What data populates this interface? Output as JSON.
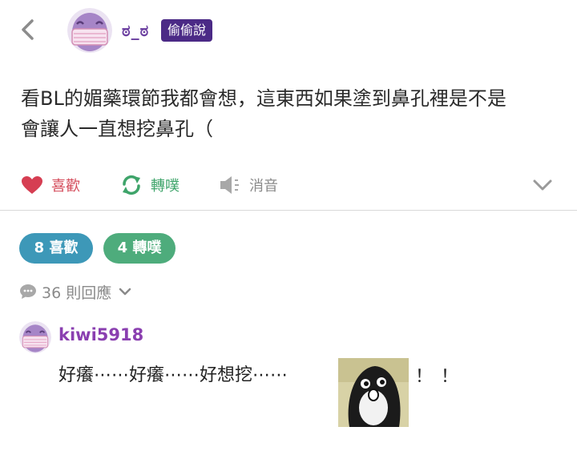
{
  "header": {
    "username": "ಠ_ಠ",
    "badge": "偷偷說"
  },
  "post": {
    "lines": [
      "看BL的媚藥環節我都會想，這東西如果塗到鼻孔裡是不是",
      "會讓人一直想挖鼻孔（"
    ]
  },
  "actions": {
    "like": "喜歡",
    "replurk": "轉噗",
    "mute": "消音"
  },
  "stats": {
    "likes": "8 喜歡",
    "replurks": "4 轉噗",
    "responses": "36 則回應"
  },
  "comment": {
    "username": "kiwi5918",
    "text": "好癢⋯⋯好癢⋯⋯好想挖⋯⋯",
    "trailing": "！！"
  },
  "colors": {
    "brand_purple": "#4b2a86",
    "like_red": "#d44b5a",
    "replurk_green": "#3ea46a",
    "pill_blue": "#3d98b8",
    "pill_green": "#4eac7c",
    "comment_user": "#8a3fb0"
  },
  "icons": {
    "back": "chevron-left-icon",
    "like": "heart-icon",
    "replurk": "refresh-icon",
    "mute": "speaker-mute-icon",
    "more": "chevron-down-icon",
    "responses": "speech-bubble-icon"
  }
}
